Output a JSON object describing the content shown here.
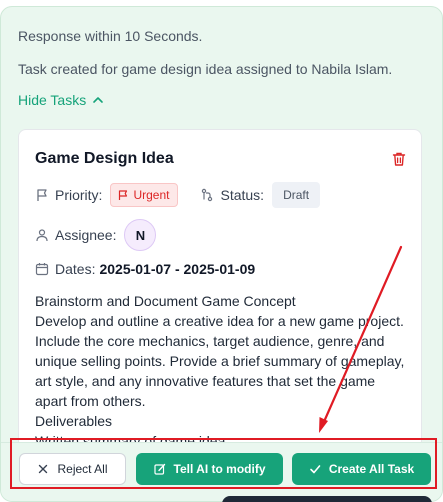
{
  "chat": {
    "response_time": "Response within 10 Seconds.",
    "task_message": "Task created for game design idea assigned to Nabila Islam.",
    "hide_tasks_label": "Hide Tasks"
  },
  "task": {
    "title": "Game Design Idea",
    "priority_label": "Priority:",
    "priority_value": "Urgent",
    "status_label": "Status:",
    "status_value": "Draft",
    "assignee_label": "Assignee:",
    "assignee_initial": "N",
    "dates_label": "Dates:",
    "dates_value": "2025-01-07 - 2025-01-09",
    "description_lines": [
      "Brainstorm and Document Game Concept",
      "Develop and outline a creative idea for a new game project. Include the core mechanics, target audience, genre, and unique selling points. Provide a brief summary of gameplay, art style, and any innovative features that set the game apart from others.",
      "Deliverables",
      "Written summary of game idea"
    ]
  },
  "actions": {
    "reject_label": "Reject All",
    "modify_label": "Tell AI to modify",
    "create_label": "Create All Task"
  },
  "colors": {
    "accent": "#17a37a",
    "urgent": "#dc2626",
    "annotation": "#e01b24"
  }
}
